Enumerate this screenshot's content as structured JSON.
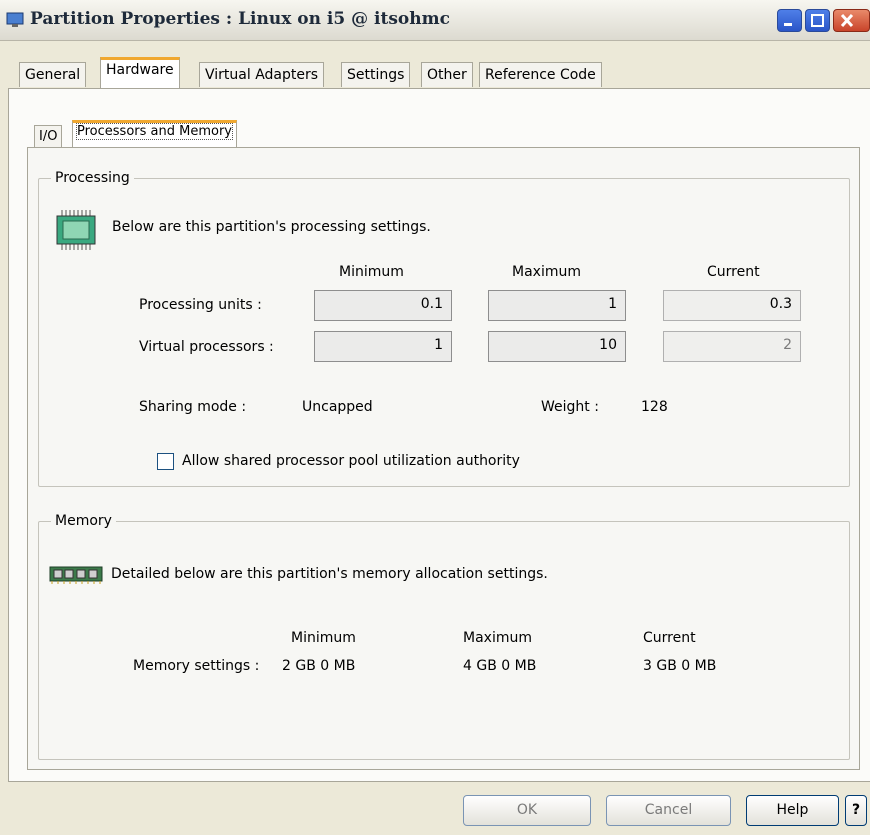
{
  "window": {
    "title": "Partition Properties : Linux on i5 @ itsohmc",
    "buttons": [
      "minimize-icon",
      "maximize-icon",
      "close-icon"
    ]
  },
  "tabs": [
    {
      "label": "General"
    },
    {
      "label": "Hardware",
      "active": true
    },
    {
      "label": "Virtual Adapters"
    },
    {
      "label": "Settings"
    },
    {
      "label": "Other"
    },
    {
      "label": "Reference Code"
    }
  ],
  "subtabs": [
    {
      "label": "I/O"
    },
    {
      "label": "Processors and Memory",
      "active": true
    }
  ],
  "processing": {
    "legend": "Processing",
    "description": "Below are this partition's processing settings.",
    "icon": "processor-chip-icon",
    "headers": {
      "minimum": "Minimum",
      "maximum": "Maximum",
      "current": "Current"
    },
    "rows": [
      {
        "label": "Processing units :",
        "minimum": "0.1",
        "maximum": "1",
        "current": "0.3"
      },
      {
        "label": "Virtual processors :",
        "minimum": "1",
        "maximum": "10",
        "current": "2"
      }
    ],
    "sharing_mode_label": "Sharing mode :",
    "sharing_mode_value": "Uncapped",
    "weight_label": "Weight :",
    "weight_value": "128",
    "checkbox_label": "Allow shared processor pool utilization authority",
    "checkbox_checked": false
  },
  "memory": {
    "legend": "Memory",
    "description": "Detailed below are this partition's memory allocation settings.",
    "icon": "memory-module-icon",
    "headers": {
      "minimum": "Minimum",
      "maximum": "Maximum",
      "current": "Current"
    },
    "row_label": "Memory settings :",
    "minimum": "2 GB 0 MB",
    "maximum": "4 GB 0 MB",
    "current": "3 GB 0 MB"
  },
  "footer": {
    "ok": "OK",
    "cancel": "Cancel",
    "help": "Help",
    "question": "?"
  },
  "colors": {
    "tab_accent": "#f0a830",
    "dialog_bg": "#ece9d8",
    "close_button": "#c9442a"
  }
}
